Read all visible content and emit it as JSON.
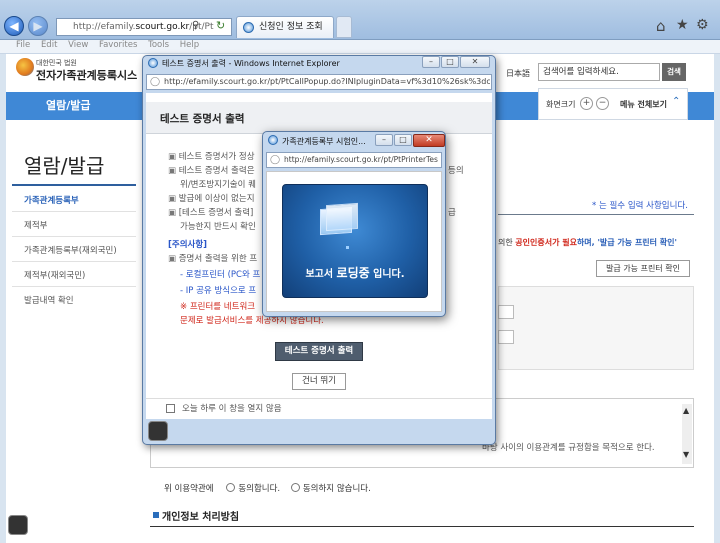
{
  "browser": {
    "address_prefix": "http://efamily.",
    "address_host": "scourt.go.kr",
    "address_path": "/pt/Pt",
    "tab_title": "신청인 정보 조회",
    "menu": [
      "File",
      "Edit",
      "View",
      "Favorites",
      "Tools",
      "Help"
    ]
  },
  "site": {
    "org_small": "대한민국 법원",
    "name": "전자가족관계등록시스",
    "lang": "日本語",
    "search_placeholder": "검색어를 입력하세요.",
    "search_button": "검색",
    "nav_first": "열람/발급",
    "font_size_label": "화면크기",
    "menu_all_label": "메뉴 전체보기",
    "page_heading": "열람/발급",
    "sidebar": [
      "가족관계등록부",
      "제적부",
      "가족관계등록부(재외국민)",
      "제적부(재외국민)",
      "발급내역 확인"
    ],
    "required_note": "* 는 필수 입력 사항입니다.",
    "cert_note_prefix": "의한 ",
    "cert_note_red": "공인인증서가 필요",
    "cert_note_suffix": "하며, '발급 가능 프린터 확인'",
    "printer_check_button": "발급 가능 프린터 확인",
    "terms_text": "바탕 사이의 이용관계를 규정함을 목적으로 한다.",
    "agree_prompt": "위 이용약관에",
    "agree_yes": "동의합니다.",
    "agree_no": "동의하지 않습니다.",
    "privacy_heading": "개인정보 처리방침"
  },
  "popup1": {
    "window_title": "테스트 증명서 출력 - Windows Internet Explorer",
    "address": "http://efamily.scourt.go.kr/pt/PtCallPopup.do?INIpluginData=vf%3d10%26sk%3dcseWNc",
    "heading": "테스트 증명서 출력",
    "lines": [
      "테스트 증명서가 정상",
      "테스트 증명서 출력은",
      "위/변조방지기술이 퀘",
      "발급에 이상이 없는지",
      "[테스트 증명서 출력]",
      "가능한지 반드시 확인"
    ],
    "line_tails": [
      "",
      "등의",
      "",
      "",
      "급",
      ""
    ],
    "notice_heading": "[주의사항]",
    "notice_line": "증명서 출력을 위한 프",
    "sub1": "- 로컬프린터 (PC와 프",
    "sub2": "- IP 공유 방식으로 프",
    "warn1": "※ 프린터를 네트워크",
    "warn2": "문제로 발급서비스를 제공하지 않습니다.",
    "print_button": "테스트 증명서 출력",
    "close_button": "건너 뛰기",
    "checkbox_label": "오늘 하루 이 창을 열지 않음"
  },
  "popup2": {
    "window_title": "가족관계등록부 시험인...",
    "address": "http://efamily.scourt.go.kr/pt/PtPrinterTes",
    "loading_prefix": "보고서 ",
    "loading_emph": "로딩중",
    "loading_suffix": " 입니다."
  },
  "colors": {
    "nav_blue": "#3f88d6",
    "loading_bg": "#1f5fa6",
    "warning_red": "#d0281c"
  }
}
